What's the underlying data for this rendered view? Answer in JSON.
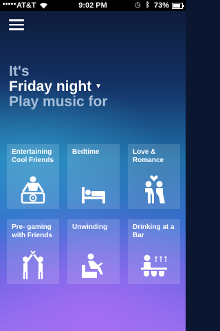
{
  "status_bar": {
    "carrier": "AT&T",
    "time": "9:02 PM",
    "battery": "73%",
    "battery_level": 0.73
  },
  "header": {
    "prefix": "It's",
    "context": "Friday night",
    "prompt": "Play music for"
  },
  "activities": [
    {
      "label": "Entertaining Cool Friends",
      "icon": "dj-turntable-icon"
    },
    {
      "label": "Bedtime",
      "icon": "bed-icon"
    },
    {
      "label": "Love & Romance",
      "icon": "couple-kiss-icon"
    },
    {
      "label": "Pre- gaming with Friends",
      "icon": "toast-cheers-icon"
    },
    {
      "label": "Unwinding",
      "icon": "armchair-relax-icon"
    },
    {
      "label": "Drinking at a Bar",
      "icon": "bar-counter-icon"
    }
  ]
}
